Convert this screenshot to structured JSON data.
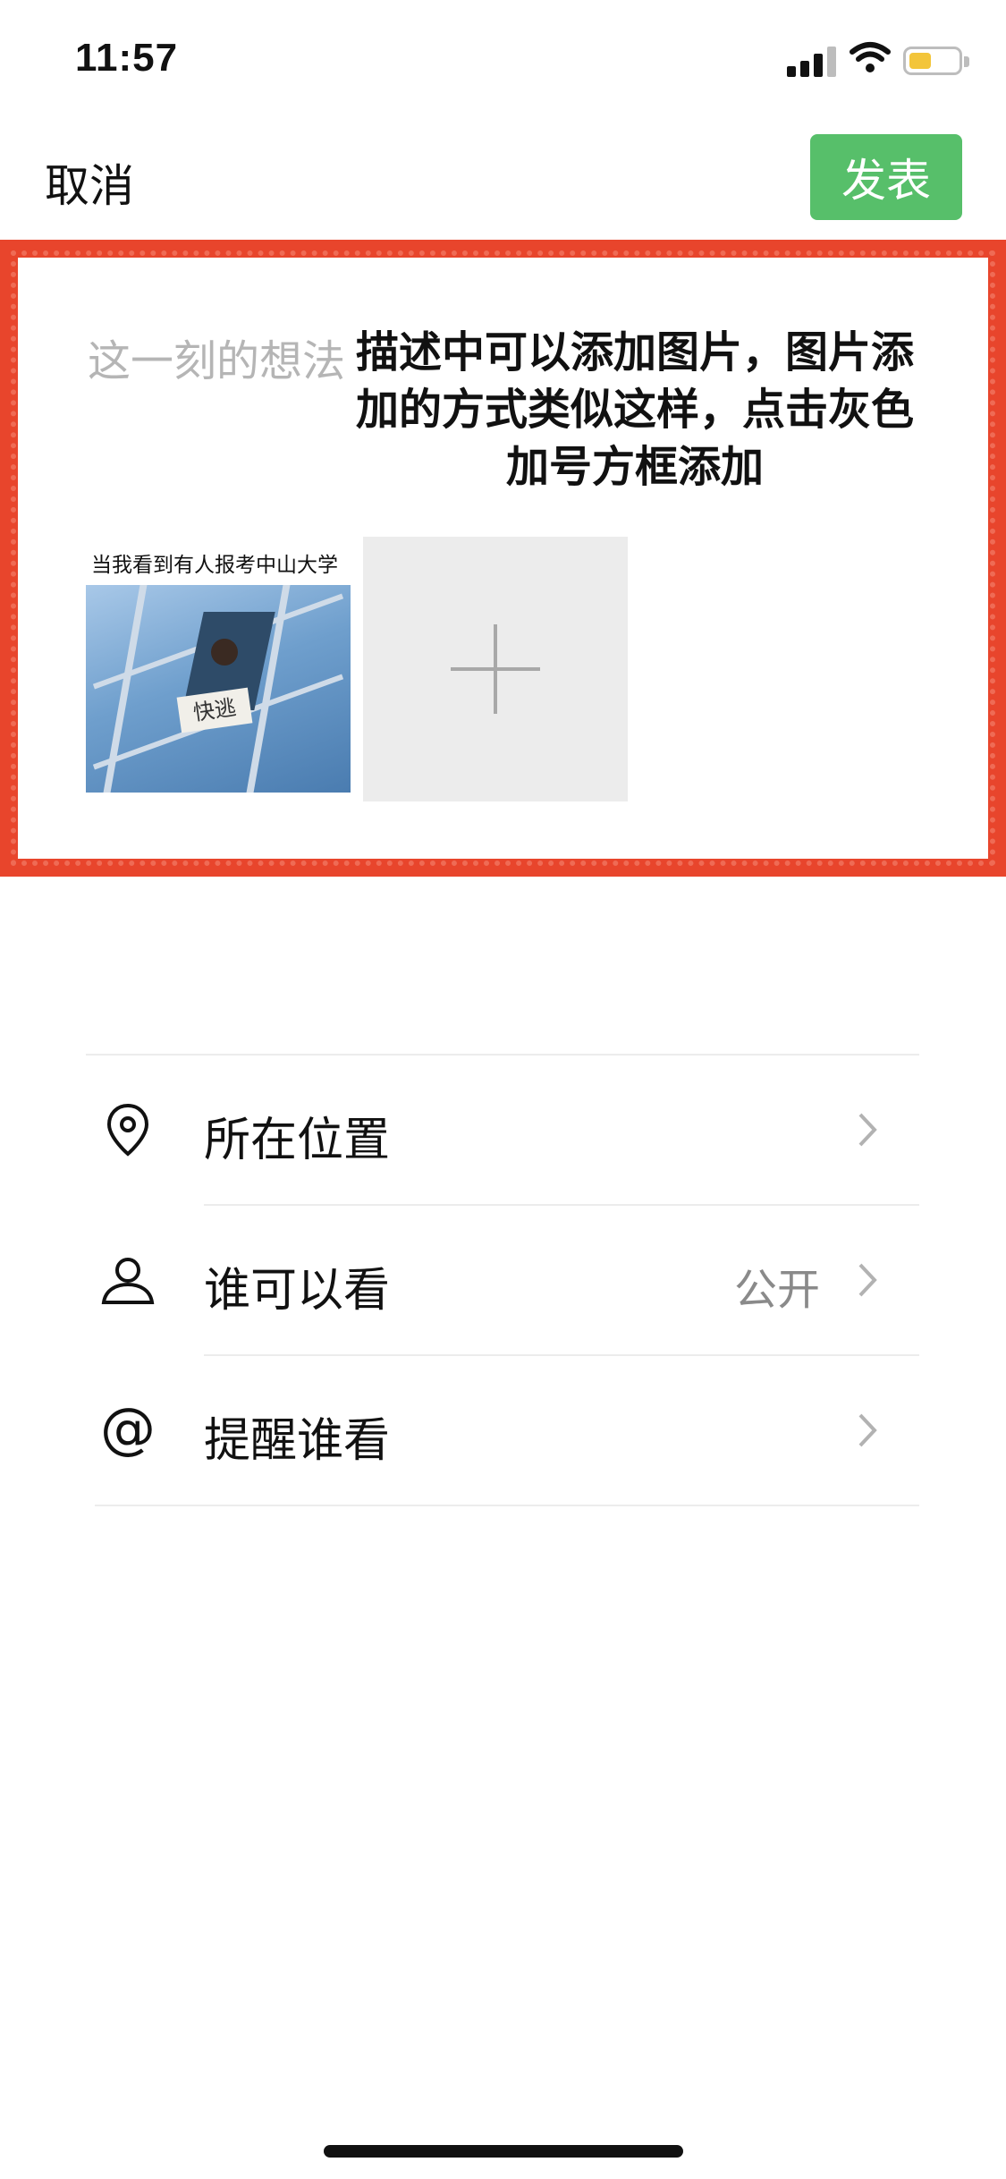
{
  "status_bar": {
    "time": "11:57"
  },
  "nav": {
    "cancel_label": "取消",
    "publish_label": "发表",
    "publish_color": "#57bf6a"
  },
  "compose": {
    "placeholder": "这一刻的想法",
    "annotation": "描述中可以添加图片，图片添加的方式类似这样，点击灰色加号方框添加",
    "frame_color": "#e8452c",
    "photo": {
      "caption": "当我看到有人报考中山大学",
      "sign_text": "快逃"
    }
  },
  "options": [
    {
      "icon": "location-pin-icon",
      "label": "所在位置",
      "value": ""
    },
    {
      "icon": "person-icon",
      "label": "谁可以看",
      "value": "公开"
    },
    {
      "icon": "at-sign-icon",
      "label": "提醒谁看",
      "value": ""
    }
  ]
}
